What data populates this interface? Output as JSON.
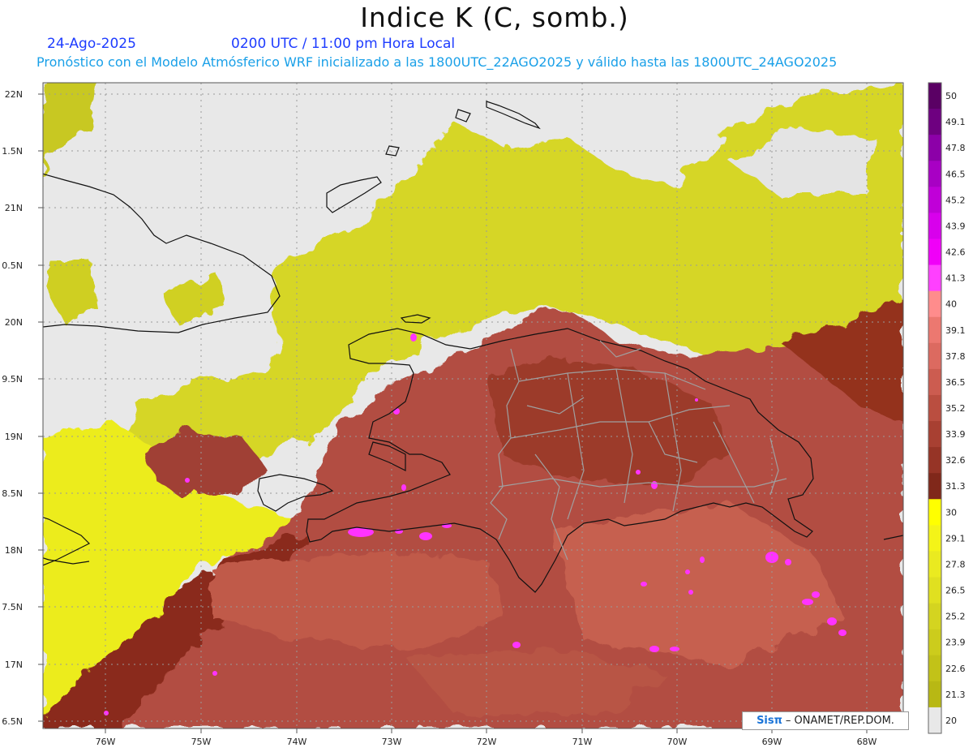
{
  "header": {
    "title": "Indice K (C, somb.)",
    "date": "24-Ago-2025",
    "time": "0200 UTC / 11:00 pm Hora Local",
    "forecast_line": "Pronóstico con el Modelo Atmósferico WRF inicializado a las 1800UTC_22AGO2025 y válido hasta las  1800UTC_24AGO2025"
  },
  "axes": {
    "lat_labels": [
      "22N",
      "1.5N",
      "21N",
      "0.5N",
      "20N",
      "9.5N",
      "19N",
      "8.5N",
      "18N",
      "7.5N",
      "17N",
      "6.5N"
    ],
    "lon_labels": [
      "76W",
      "75W",
      "74W",
      "73W",
      "72W",
      "71W",
      "70W",
      "69W",
      "68W"
    ]
  },
  "colorbar": {
    "levels": [
      "50",
      "49.1",
      "47.8",
      "46.5",
      "45.2",
      "43.9",
      "42.6",
      "41.3",
      "40",
      "39.1",
      "37.8",
      "36.5",
      "35.2",
      "33.9",
      "32.6",
      "31.3",
      "30",
      "29.1",
      "27.8",
      "26.5",
      "25.2",
      "23.9",
      "22.6",
      "21.3",
      "20"
    ],
    "colors": [
      "#5a0064",
      "#6e0080",
      "#8c00a8",
      "#a800c4",
      "#c000d8",
      "#d800ec",
      "#f000f8",
      "#ff40ff",
      "#ff8c8c",
      "#ec7870",
      "#dc6a60",
      "#cc5c50",
      "#ba4e40",
      "#a84032",
      "#963426",
      "#80281a",
      "#ffff00",
      "#f4f418",
      "#eaea20",
      "#e0e020",
      "#d4d420",
      "#cccc1c",
      "#c2c218",
      "#b8b814",
      "#e8e8e8"
    ]
  },
  "credit": {
    "logo": "Sisπ",
    "text": "– ONAMET/REP.DOM."
  }
}
